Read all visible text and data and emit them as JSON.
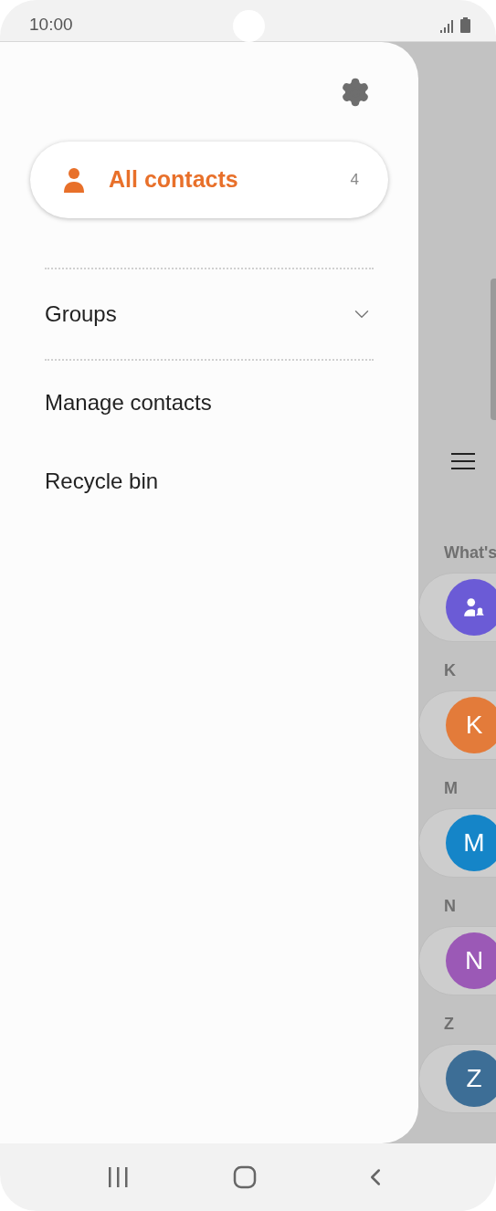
{
  "status_bar": {
    "time": "10:00"
  },
  "drawer": {
    "all_contacts": {
      "label": "All contacts",
      "count": "4",
      "selected": true
    },
    "groups": {
      "label": "Groups",
      "expanded": false
    },
    "items": [
      "Manage contacts",
      "Recycle bin"
    ]
  },
  "background": {
    "sections": [
      {
        "header": "What's",
        "kind": "icon",
        "color": "#6b5bd6"
      },
      {
        "header": "K",
        "kind": "letter",
        "initial": "K",
        "color": "#e37b3a"
      },
      {
        "header": "M",
        "kind": "letter",
        "initial": "M",
        "color": "#1585c8"
      },
      {
        "header": "N",
        "kind": "letter",
        "initial": "N",
        "color": "#9b59b6"
      },
      {
        "header": "Z",
        "kind": "letter",
        "initial": "Z",
        "color": "#3d6e96"
      }
    ]
  }
}
